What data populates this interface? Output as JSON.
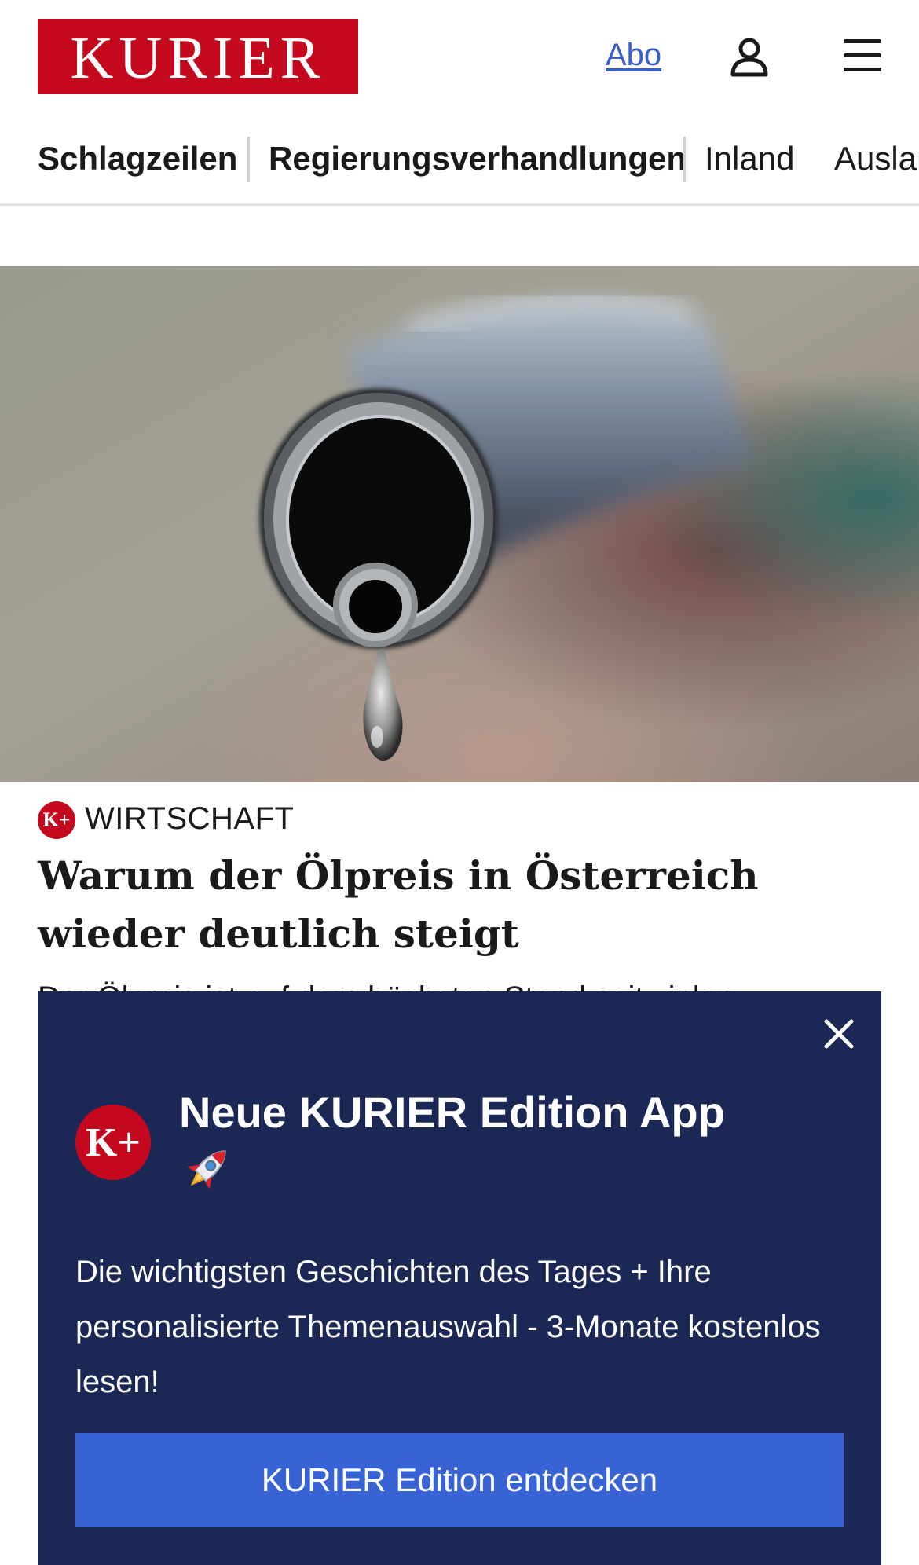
{
  "header": {
    "logo_text": "KURIER",
    "abo_label": "Abo",
    "user_icon": "user-icon",
    "menu_icon": "hamburger-menu-icon"
  },
  "nav": {
    "items": [
      "Schlagzeilen",
      "Regierungsverhandlungen",
      "Inland",
      "Ausland"
    ]
  },
  "article": {
    "badge_text": "K+",
    "category": "WIRTSCHAFT",
    "headline": "Warum der Ölpreis in Österreich wieder deutlich steigt",
    "teaser_partial": "Der Ölpreis ist auf dem höchsten Stand seit vielen"
  },
  "popup": {
    "badge_text": "K+",
    "title": "Neue KURIER Edition App",
    "title_icon": "rocket-icon",
    "text": "Die wichtigsten Geschichten des Tages + Ihre personalisierte Themenauswahl - 3-Monate kostenlos lesen!",
    "cta_label": "KURIER Edition entdecken",
    "close_icon": "close-icon"
  },
  "colors": {
    "brand_red": "#c4091f",
    "popup_bg": "#1b2856",
    "cta_blue": "#3763d5",
    "link_blue": "#3a5fcd"
  }
}
